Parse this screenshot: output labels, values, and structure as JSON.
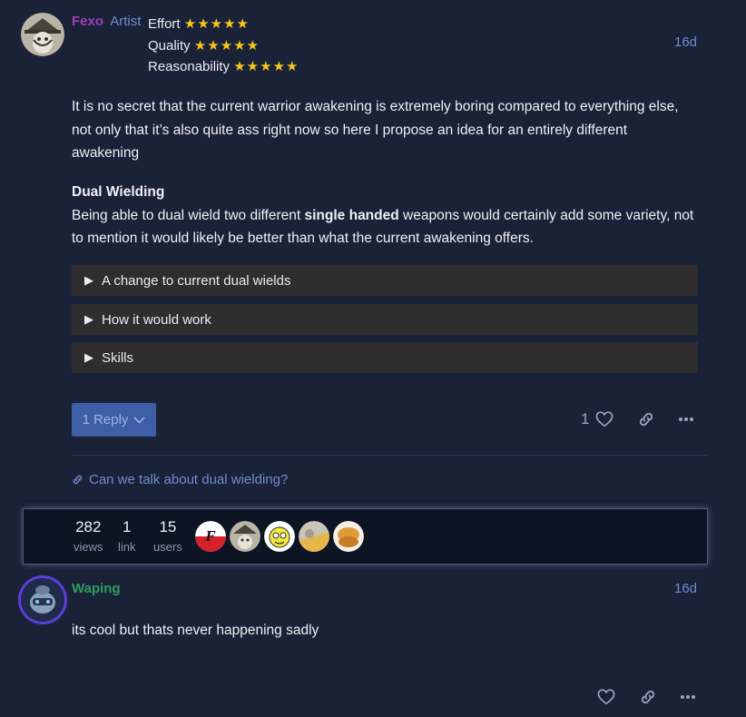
{
  "post1": {
    "username": "Fexo",
    "title": "Artist",
    "ratings": [
      {
        "label": "Effort",
        "stars": "★★★★★"
      },
      {
        "label": "Quality",
        "stars": "★★★★★"
      },
      {
        "label": "Reasonability",
        "stars": "★★★★★"
      }
    ],
    "date": "16d",
    "paragraph1": "It is no secret that the current warrior awakening is extremely boring compared to everything else, not only that it’s also quite ass right now so here I propose an idea for an entirely different awakening",
    "heading": "Dual Wielding",
    "paragraph2_before": "Being able to dual wield two different ",
    "paragraph2_bold": "single handed",
    "paragraph2_after": " weapons would certainly add some variety, not to mention it would likely be better than what the current awakening offers.",
    "details": [
      {
        "label": "A change to current dual wields"
      },
      {
        "label": "How it would work"
      },
      {
        "label": "Skills"
      }
    ],
    "reply_button": "1 Reply",
    "like_count": "1"
  },
  "topic_link": "Can we talk about dual wielding?",
  "stats": {
    "views": {
      "num": "282",
      "label": "views"
    },
    "links": {
      "num": "1",
      "label": "link"
    },
    "users": {
      "num": "15",
      "label": "users"
    }
  },
  "post2": {
    "username": "Waping",
    "date": "16d",
    "text": "its cool but thats never happening sadly"
  },
  "colors": {
    "background": "#1a2238",
    "fexo_name": "#9b3fb5",
    "waping_name": "#2e9e5b",
    "link_blue": "#6f8bd0",
    "reply_button": "#3e5ea6",
    "stars": "#f5c518"
  }
}
